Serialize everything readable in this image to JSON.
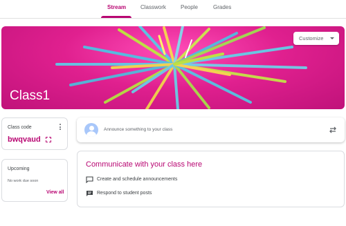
{
  "tabs": [
    {
      "label": "Stream",
      "active": true
    },
    {
      "label": "Classwork",
      "active": false
    },
    {
      "label": "People",
      "active": false
    },
    {
      "label": "Grades",
      "active": false
    }
  ],
  "banner": {
    "class_name": "Class1",
    "customize_label": "Customize",
    "info_icon": "info-icon"
  },
  "class_code": {
    "label": "Class code",
    "value": "bwqvaud",
    "menu_icon": "more-vert-icon",
    "expand_icon": "fullscreen-icon"
  },
  "upcoming": {
    "title": "Upcoming",
    "empty_text": "No work due soon",
    "view_all_label": "View all"
  },
  "announce": {
    "placeholder": "Announce something to your class",
    "repost_icon": "repost-icon"
  },
  "communicate": {
    "title": "Communicate with your class here",
    "items": [
      {
        "icon": "chat-bubble-icon",
        "label": "Create and schedule announcements"
      },
      {
        "icon": "comment-list-icon",
        "label": "Respond to student posts"
      }
    ]
  },
  "colors": {
    "accent": "#b80672",
    "banner": "#e0208f"
  }
}
